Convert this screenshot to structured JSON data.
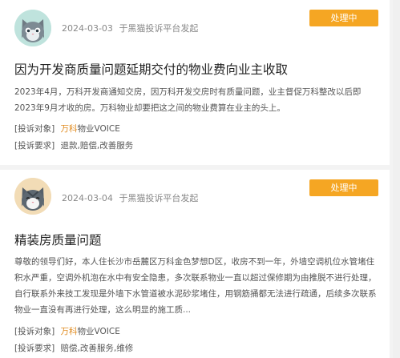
{
  "colors": {
    "status_bg": "#f5a623",
    "brand_text": "#e08a1e",
    "page_bg": "#f3f3f3"
  },
  "posts": [
    {
      "avatar_icon": "gray-cat-avatar-icon",
      "date": "2024-03-03",
      "source": "于黑猫投诉平台发起",
      "status": "处理中",
      "title": "因为开发商质量问题延期交付的物业费向业主收取",
      "body": "2023年4月，万科开发商通知交房，因万科开发交房时有质量问题，业主督促万科整改以后即2023年9月才收的房。万科物业却要把这之间的物业费算在业主的头上。",
      "target_label": "[投诉对象]",
      "target_brand": "万科",
      "target_rest": "物业VOICE",
      "request_label": "[投诉要求]",
      "request_value": "退款,赔偿,改善服务"
    },
    {
      "avatar_icon": "tabby-cat-avatar-icon",
      "date": "2024-03-04",
      "source": "于黑猫投诉平台发起",
      "status": "处理中",
      "title": "精装房质量问题",
      "body": "尊敬的领导们好，本人住长沙市岳麓区万科金色梦想D区，收房不到一年，外墙空调机位水管堵住积水严重，空调外机泡在水中有安全隐患，多次联系物业一直以超过保修期为由推脱不进行处理，自行联系外来技工发现是外墙下水管道被水泥砂浆堵住，用钢筋捅都无法进行疏通，后续多次联系物业一直没有再进行处理，这么明显的施工质...",
      "target_label": "[投诉对象]",
      "target_brand": "万科",
      "target_rest": "物业VOICE",
      "request_label": "[投诉要求]",
      "request_value": "赔偿,改善服务,维修"
    }
  ]
}
